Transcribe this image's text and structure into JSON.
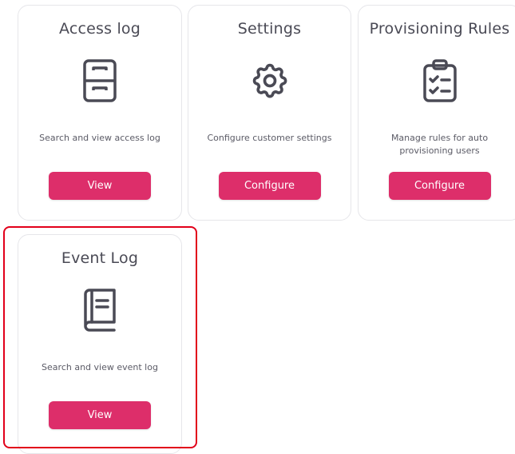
{
  "cards": [
    {
      "title": "Access log",
      "icon": "archive-drawer-icon",
      "description": "Search and view access log",
      "button_label": "View"
    },
    {
      "title": "Settings",
      "icon": "gear-icon",
      "description": "Configure customer settings",
      "button_label": "Configure"
    },
    {
      "title": "Provisioning Rules",
      "icon": "clipboard-checklist-icon",
      "description": "Manage rules for auto provisioning users",
      "button_label": "Configure"
    },
    {
      "title": "Event Log",
      "icon": "book-icon",
      "description": "Search and view event log",
      "button_label": "View"
    }
  ],
  "colors": {
    "button": "#dd2e6a",
    "highlight_border": "#e2001a",
    "icon": "#4a4a55"
  }
}
